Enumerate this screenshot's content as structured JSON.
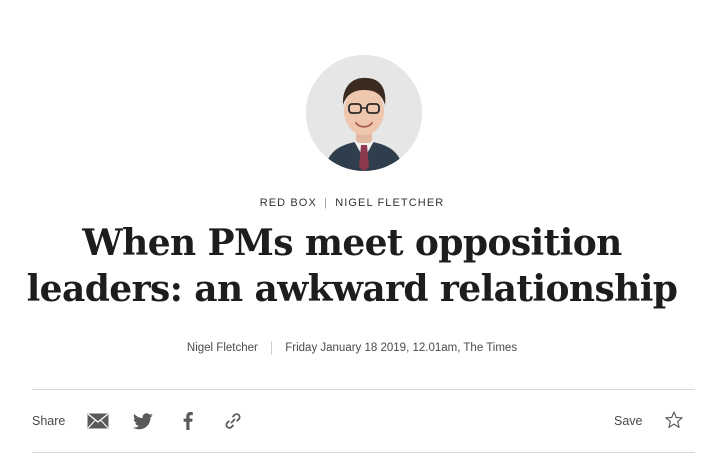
{
  "article": {
    "section": "RED BOX",
    "columnist": "NIGEL FLETCHER",
    "headline_line1": "When PMs meet opposition",
    "headline_line2": "leaders: an awkward relationship",
    "author": "Nigel Fletcher",
    "dateline": "Friday January 18 2019, 12.01am, The Times"
  },
  "share_bar": {
    "share_label": "Share",
    "save_label": "Save",
    "icons": [
      "email-icon",
      "twitter-icon",
      "facebook-icon",
      "link-icon",
      "star-icon"
    ]
  },
  "colors": {
    "text": "#1d1d1b",
    "muted": "#4a4a4a",
    "icon": "#5a5a5a",
    "rule": "#d8d8d8",
    "avatar_bg": "#e6e6e6"
  }
}
